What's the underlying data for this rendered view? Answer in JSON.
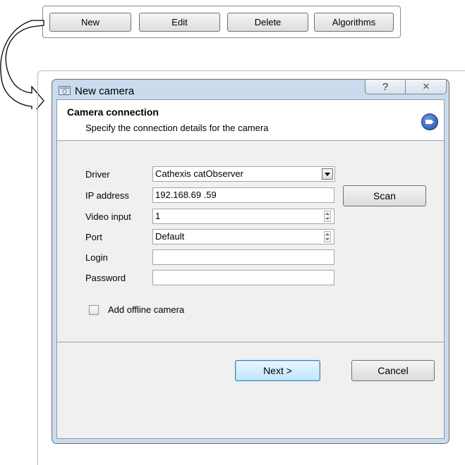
{
  "toolbar": {
    "buttons": [
      "New",
      "Edit",
      "Delete",
      "Algorithms"
    ]
  },
  "dialog": {
    "title": "New camera",
    "help_glyph": "?",
    "close_glyph": "✕",
    "header": {
      "title": "Camera connection",
      "subtitle": "Specify the connection details for the camera"
    },
    "fields": {
      "driver": {
        "label": "Driver",
        "value": "Cathexis catObserver"
      },
      "ip": {
        "label": "IP address",
        "value": "192.168.69 .59"
      },
      "video_input": {
        "label": "Video input",
        "value": "1"
      },
      "port": {
        "label": "Port",
        "value": "Default"
      },
      "login": {
        "label": "Login",
        "value": ""
      },
      "password": {
        "label": "Password",
        "value": ""
      }
    },
    "scan_label": "Scan",
    "offline": {
      "label": "Add offline camera",
      "checked": false
    },
    "next_label": "Next >",
    "cancel_label": "Cancel"
  },
  "colors": {
    "dialog_frame": "#c9dbed",
    "body": "#f0f0f0",
    "default_button": "#bee6fd"
  }
}
